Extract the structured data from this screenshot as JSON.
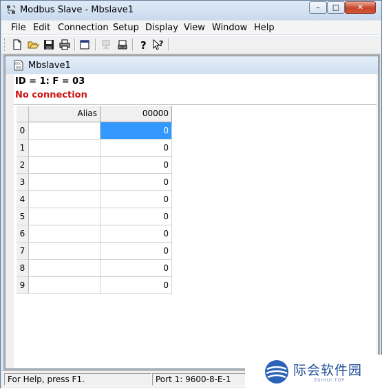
{
  "window": {
    "title": "Modbus Slave - Mbslave1",
    "controls": {
      "minimize": "–",
      "maximize": "□",
      "close": "✕"
    }
  },
  "menu": [
    "File",
    "Edit",
    "Connection",
    "Setup",
    "Display",
    "View",
    "Window",
    "Help"
  ],
  "toolbar": {
    "buttons": [
      "new-document",
      "open-folder",
      "save",
      "print",
      "window",
      "connect",
      "disconnect",
      "about",
      "context-help"
    ]
  },
  "child_window": {
    "title": "Mbslave1",
    "id_line": "ID = 1: F = 03",
    "status": "No connection"
  },
  "grid": {
    "headers": [
      "Alias",
      "00000"
    ],
    "rows": [
      {
        "index": "0",
        "alias": "",
        "value": "0"
      },
      {
        "index": "1",
        "alias": "",
        "value": "0"
      },
      {
        "index": "2",
        "alias": "",
        "value": "0"
      },
      {
        "index": "3",
        "alias": "",
        "value": "0"
      },
      {
        "index": "4",
        "alias": "",
        "value": "0"
      },
      {
        "index": "5",
        "alias": "",
        "value": "0"
      },
      {
        "index": "6",
        "alias": "",
        "value": "0"
      },
      {
        "index": "7",
        "alias": "",
        "value": "0"
      },
      {
        "index": "8",
        "alias": "",
        "value": "0"
      },
      {
        "index": "9",
        "alias": "",
        "value": "0"
      }
    ],
    "selected_row": 0
  },
  "statusbar": {
    "help": "For Help, press F1.",
    "port": "Port 1: 9600-8-E-1"
  },
  "watermark": {
    "text": "际会软件园",
    "sub": "ZUIHUI.TOP"
  },
  "colors": {
    "status_text": "#cc1111",
    "selection": "#3399ff",
    "watermark": "#1f4e96"
  }
}
